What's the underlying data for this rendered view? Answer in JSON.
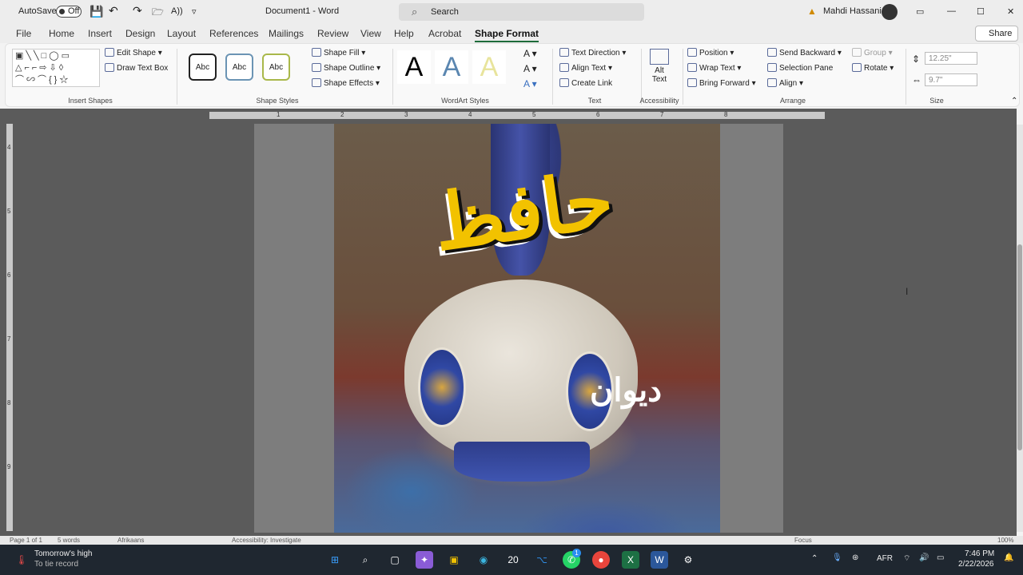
{
  "titlebar": {
    "autosave_label": "AutoSave",
    "autosave_state": "Off",
    "doc_title": "Document1 - Word",
    "search_placeholder": "Search",
    "user_name": "Mahdi Hassani"
  },
  "tabs": [
    "File",
    "Home",
    "Insert",
    "Design",
    "Layout",
    "References",
    "Mailings",
    "Review",
    "View",
    "Help",
    "Acrobat",
    "Shape Format"
  ],
  "active_tab": "Shape Format",
  "share_label": "Share",
  "ribbon": {
    "insert_shapes": {
      "edit_shape": "Edit Shape",
      "draw_text_box": "Draw Text Box",
      "label": "Insert Shapes"
    },
    "shape_styles": {
      "style_sample": "Abc",
      "fill": "Shape Fill",
      "outline": "Shape Outline",
      "effects": "Shape Effects",
      "label": "Shape Styles"
    },
    "wordart_styles": {
      "sample": "A",
      "label": "WordArt Styles"
    },
    "text": {
      "direction": "Text Direction",
      "align": "Align Text",
      "link": "Create Link",
      "label": "Text"
    },
    "accessibility": {
      "alt1": "Alt",
      "alt2": "Text",
      "label": "Accessibility"
    },
    "arrange": {
      "position": "Position",
      "wrap": "Wrap Text",
      "forward": "Bring Forward",
      "backward": "Send Backward",
      "selection": "Selection Pane",
      "align": "Align",
      "group": "Group",
      "rotate": "Rotate",
      "label": "Arrange"
    },
    "size": {
      "height": "12.25\"",
      "width": "9.7\"",
      "label": "Size"
    }
  },
  "ruler": {
    "h": [
      "1",
      "2",
      "3",
      "4",
      "5",
      "6",
      "7",
      "8"
    ],
    "v": [
      "4",
      "5",
      "6",
      "7",
      "8",
      "9"
    ]
  },
  "document": {
    "calligraphy_main": "حافظ",
    "calligraphy_sub": "دیوان"
  },
  "statusbar": {
    "page": "Page 1 of 1",
    "words": "5 words",
    "language": "Afrikaans",
    "accessibility": "Accessibility: Investigate",
    "focus": "Focus",
    "zoom": "100%"
  },
  "taskbar": {
    "weather_title": "Tomorrow's high",
    "weather_sub": "To tie record",
    "lang": "AFR",
    "time": "7:46 PM",
    "date": "2/22/2026",
    "app_badge": "1"
  }
}
